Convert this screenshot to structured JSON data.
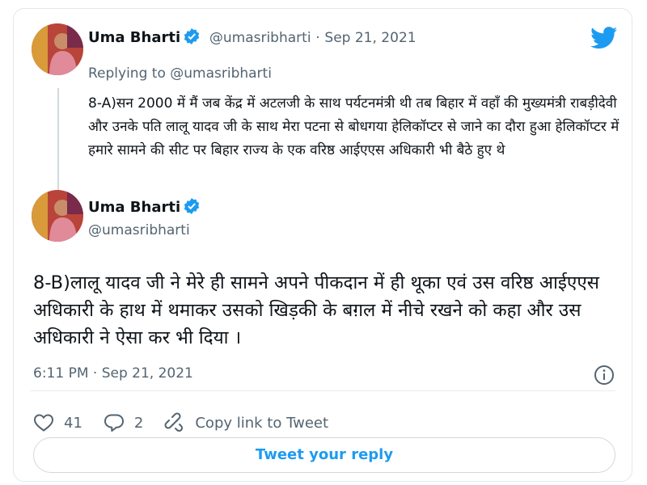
{
  "colors": {
    "accent": "#1d9bf0",
    "text": "#0f1419",
    "secondary": "#536471",
    "border": "#e1e8ed"
  },
  "first_tweet": {
    "name": "Uma Bharti",
    "handle": "@umasribharti",
    "separator": "·",
    "date": "Sep 21, 2021",
    "replying_to_prefix": "Replying to",
    "replying_to_handle": "@umasribharti",
    "text": "8-A)सन 2000 में मैं जब केंद्र में अटलजी के साथ पर्यटनमंत्री थी तब बिहार में वहाँ की मुख्यमंत्री राबड़ीदेवी और उनके पति लालू यादव जी के साथ मेरा पटना से बोधगया हेलिकॉप्टर से जाने का दौरा हुआ हेलिकॉप्टर में हमारे सामने की सीट पर बिहार राज्य के एक वरिष्ठ आईएएस अधिकारी भी बैठे हुए थे"
  },
  "main_tweet": {
    "name": "Uma Bharti",
    "handle": "@umasribharti",
    "text": "8-B)लालू यादव जी ने मेरे ही सामने अपने पीकदान में ही थूका एवं उस वरिष्ठ आईएएस अधिकारी के हाथ में थमाकर उसको खिड़की के बग़ल में नीचे रखने को कहा और उस अधिकारी ने ऐसा कर भी दिया ।",
    "timestamp": "6:11 PM · Sep 21, 2021",
    "likes": "41",
    "replies": "2",
    "copy_link": "Copy link to Tweet",
    "reply_button": "Tweet your reply"
  },
  "icons": [
    "twitter-bird-icon",
    "verified-badge-icon",
    "info-icon",
    "heart-icon",
    "reply-bubble-icon",
    "link-icon"
  ]
}
